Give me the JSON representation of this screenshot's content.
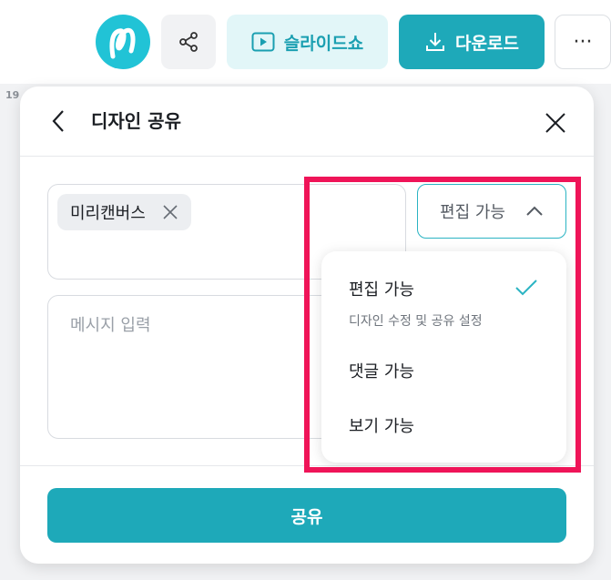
{
  "toolbar": {
    "avatar_icon": "miricanvas-logo-icon",
    "share_icon": "share-nodes-icon",
    "slideshow_label": "슬라이드쇼",
    "download_label": "다운로드",
    "more_label": "···"
  },
  "canvas": {
    "ruler_text": "19"
  },
  "dialog": {
    "title": "디자인 공유",
    "recipient_chip": "미리캔버스",
    "message_placeholder": "메시지 입력",
    "permission_selected": "편집 가능",
    "share_label": "공유"
  },
  "menu": {
    "items": [
      {
        "label": "편집 가능",
        "description": "디자인 수정 및 공유 설정",
        "selected": true
      },
      {
        "label": "댓글 가능"
      },
      {
        "label": "보기 가능"
      }
    ]
  },
  "colors": {
    "accent": "#1ea9b9",
    "highlight": "#ef1458"
  }
}
